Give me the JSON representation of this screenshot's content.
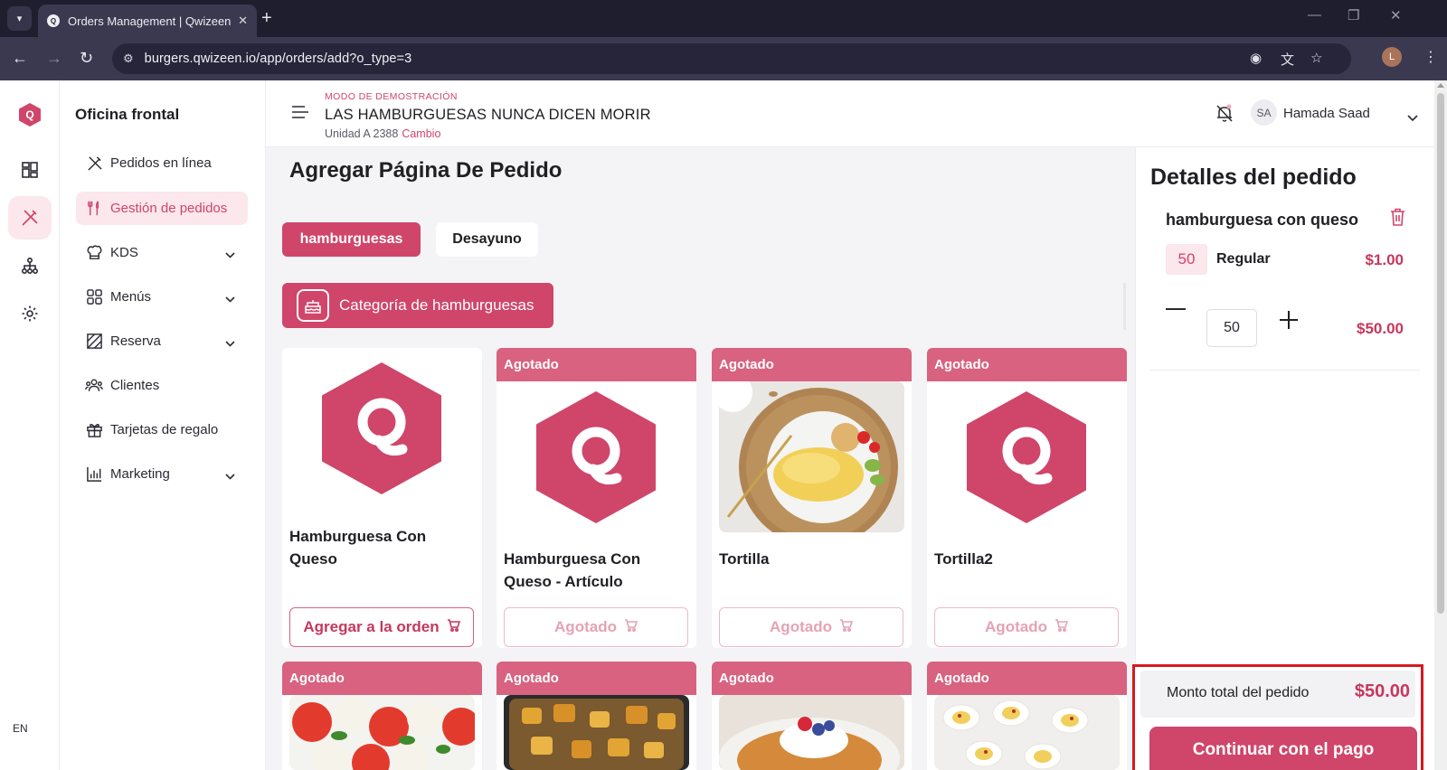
{
  "browser": {
    "tab_title": "Orders Management | Qwizeen",
    "url": "burgers.qwizeen.io/app/orders/add?o_type=3",
    "profile_initial": "L"
  },
  "rail": {
    "logo_letter": "Q",
    "language": "EN"
  },
  "sidebar": {
    "title": "Oficina frontal",
    "items": [
      {
        "label": "Pedidos en línea"
      },
      {
        "label": "Gestión de pedidos"
      },
      {
        "label": "KDS"
      },
      {
        "label": "Menús"
      },
      {
        "label": "Reserva"
      },
      {
        "label": "Clientes"
      },
      {
        "label": "Tarjetas de regalo"
      },
      {
        "label": "Marketing"
      }
    ]
  },
  "header": {
    "demo_label": "MODO DE DEMOSTRACIÓN",
    "store_name": "LAS HAMBURGUESAS NUNCA DICEN MORIR",
    "unit": "Unidad A 2388",
    "unit_change": "Cambio",
    "user_initials": "SA",
    "user_name": "Hamada Saad"
  },
  "main": {
    "title": "Agregar Página De Pedido",
    "menu_tabs": [
      "hamburguesas",
      "Desayuno"
    ],
    "category": "Categoría de hamburguesas",
    "products": [
      {
        "name": "Hamburguesa Con Queso",
        "sold_out": false,
        "button": "Agregar a la orden"
      },
      {
        "name": "Hamburguesa Con Queso - Artículo",
        "sold_out": true,
        "badge": "Agotado",
        "button": "Agotado"
      },
      {
        "name": "Tortilla",
        "sold_out": true,
        "badge": "Agotado",
        "button": "Agotado"
      },
      {
        "name": "Tortilla2",
        "sold_out": true,
        "badge": "Agotado",
        "button": "Agotado"
      }
    ],
    "row2_badges": [
      "Agotado",
      "Agotado",
      "Agotado",
      "Agotado"
    ]
  },
  "order": {
    "title": "Detalles del pedido",
    "item_name": "hamburguesa con queso",
    "qty_badge": "50",
    "variant": "Regular",
    "unit_price": "$1.00",
    "qty_value": "50",
    "line_total": "$50.00",
    "total_label": "Monto total del pedido",
    "total_value": "$50.00",
    "pay_button": "Continuar con el pago"
  },
  "colors": {
    "accent": "#d0456a",
    "soldout_band": "#d8627f",
    "price": "#c7375d",
    "highlight_border": "#d71920"
  }
}
